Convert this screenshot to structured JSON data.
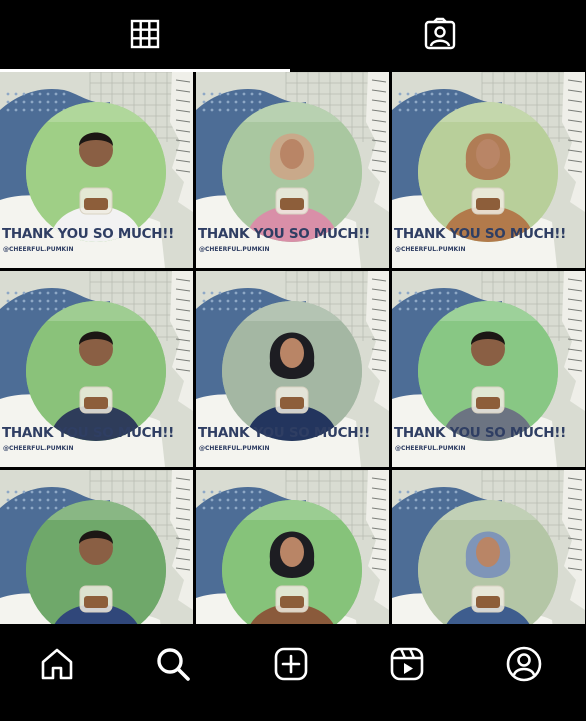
{
  "profile_tabs": [
    {
      "name": "grid-posts",
      "icon": "grid-icon",
      "active": true
    },
    {
      "name": "tagged-posts",
      "icon": "tagged-person-icon",
      "active": false
    }
  ],
  "posts": [
    {
      "caption": "THANK YOU SO MUCH!!",
      "handle": "@CHEERFUL.PUMKIN",
      "subject": "young man in white t-shirt holding a plastic bag of snacks",
      "bg": "#9fcf86",
      "outfit": "#f2f2f2",
      "head": "hair"
    },
    {
      "caption": "THANK YOU SO MUCH!!",
      "handle": "@CHEERFUL.PUMKIN",
      "subject": "young woman in beige hijab holding a plastic container",
      "bg": "#a9c7a0",
      "outfit": "#d98fa8",
      "head": "hijab-beige"
    },
    {
      "caption": "THANK YOU SO MUCH!!",
      "handle": "@CHEERFUL.PUMKIN",
      "subject": "young woman in tan hijab holding a plastic container",
      "bg": "#b8cf9a",
      "outfit": "#b27a4b",
      "head": "hijab-tan"
    },
    {
      "caption": "THANK YOU SO MUCH!!",
      "handle": "@CHEERFUL.PUMKIN",
      "subject": "young man in dark plaid shirt holding a snack bag",
      "bg": "#8ac27a",
      "outfit": "#2e3c5a",
      "head": "hair"
    },
    {
      "caption": "THANK YOU SO MUCH!!",
      "handle": "@CHEERFUL.PUMKIN",
      "subject": "young woman in black hijab and glasses holding a snack bag",
      "bg": "#a4b7a3",
      "outfit": "#23355e",
      "head": "hijab-black"
    },
    {
      "caption": "THANK YOU SO MUCH!!",
      "handle": "@CHEERFUL.PUMKIN",
      "subject": "young man in grey shirt holding a snack bag",
      "bg": "#88c784",
      "outfit": "#6c7482",
      "head": "hair"
    },
    {
      "caption": "",
      "handle": "",
      "subject": "young man in denim jacket holding a snack bag",
      "bg": "#6fa86a",
      "outfit": "#30477a",
      "head": "hair"
    },
    {
      "caption": "",
      "handle": "",
      "subject": "young woman in black hijab holding a snack bag",
      "bg": "#86c37a",
      "outfit": "#8a5a3b",
      "head": "hijab-black"
    },
    {
      "caption": "",
      "handle": "",
      "subject": "young woman in blue hijab holding a snack container",
      "bg": "#b4c6a6",
      "outfit": "#3e5d8e",
      "head": "hijab-blue"
    }
  ],
  "bottom_nav": [
    {
      "name": "home",
      "icon": "home-icon"
    },
    {
      "name": "search",
      "icon": "search-icon"
    },
    {
      "name": "create",
      "icon": "add-post-icon"
    },
    {
      "name": "reels",
      "icon": "reels-icon"
    },
    {
      "name": "profile",
      "icon": "profile-icon"
    }
  ],
  "colors": {
    "background": "#000000",
    "tile_paper": "#d9dcd2",
    "accent_blue": "#4d6d96",
    "text_navy": "#2f3e63",
    "icon": "#ffffff"
  }
}
